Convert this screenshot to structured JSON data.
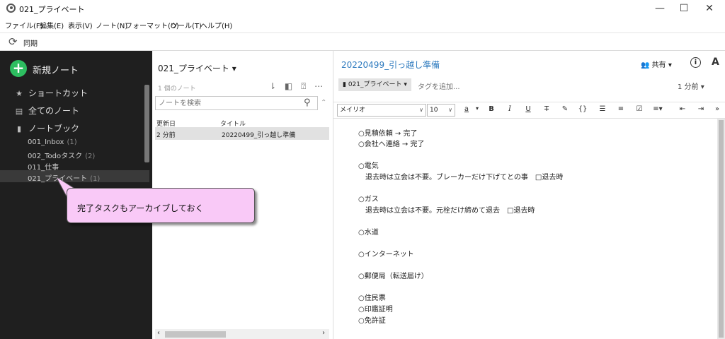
{
  "window": {
    "title": "021_プライベート",
    "minimize": "—",
    "maximize": "☐",
    "close": "✕"
  },
  "menu": [
    "ファイル(F)",
    "編集(E)",
    "表示(V)",
    "ノート(N)",
    "フォーマット(O)",
    "ツール(T)",
    "ヘルプ(H)"
  ],
  "toolbar": {
    "sync_label": "同期"
  },
  "sidebar": {
    "new_note": "新規ノート",
    "nav": [
      {
        "icon": "star-icon",
        "label": "ショートカット"
      },
      {
        "icon": "notes-icon",
        "label": "全てのノート"
      },
      {
        "icon": "notebook-icon",
        "label": "ノートブック"
      }
    ],
    "notebooks": [
      {
        "name": "001_Inbox",
        "count": "(1)"
      },
      {
        "name": "002_Todoタスク",
        "count": "(2)"
      },
      {
        "name": "011_仕事",
        "count": ""
      },
      {
        "name": "021_プライベート",
        "count": "(1)",
        "selected": true
      }
    ]
  },
  "note_list": {
    "title": "021_プライベート ▾",
    "count": "1 個のノート",
    "search_placeholder": "ノートを検索",
    "columns": [
      "更新日",
      "タイトル"
    ],
    "rows": [
      {
        "updated": "2 分前",
        "title": "20220499_引っ越し準備"
      }
    ]
  },
  "editor": {
    "title": "20220499_引っ越し準備",
    "share": "共有",
    "notebook_chip": "021_プライベート",
    "tag_placeholder": "タグを追加...",
    "time_ago": "1 分前",
    "font": "メイリオ",
    "font_size": "10",
    "lines": [
      "○見積依頼 → 完了",
      "○会社へ連絡 → 完了",
      "",
      "○電気",
      "　退去時は立会は不要。ブレーカーだけ下げてとの事　□退去時",
      "",
      "○ガス",
      "　退去時は立会は不要。元栓だけ締めて退去　□退去時",
      "",
      "○水道",
      "",
      "○インターネット",
      "",
      "○郵便局（転送届け）",
      "",
      "○住民票",
      "○印鑑証明",
      "○免許証"
    ]
  },
  "callout": {
    "text": "完了タスクもアーカイブしておく",
    "color": "#f9c9f7"
  },
  "colors": {
    "accent_green": "#2dbe60",
    "title_blue": "#2f7bbf",
    "sidebar_bg": "#1f1f1f"
  }
}
